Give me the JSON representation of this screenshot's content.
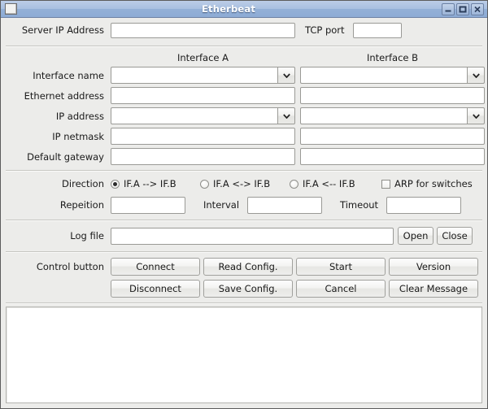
{
  "window": {
    "title": "Etherbeat",
    "icon": "app-window-icon",
    "controls": {
      "minimize": "minimize-icon",
      "maximize": "maximize-icon",
      "close": "close-icon"
    }
  },
  "server": {
    "ip_label": "Server IP Address",
    "ip_value": "",
    "ip_placeholder": "",
    "port_label": "TCP port",
    "port_value": "",
    "port_placeholder": ""
  },
  "interfaces": {
    "header_a": "Interface A",
    "header_b": "Interface B",
    "rows": [
      {
        "label": "Interface name",
        "type": "combo",
        "a_value": "",
        "b_value": ""
      },
      {
        "label": "Ethernet address",
        "type": "text",
        "a_value": "",
        "b_value": ""
      },
      {
        "label": "IP address",
        "type": "combo",
        "a_value": "",
        "b_value": ""
      },
      {
        "label": "IP netmask",
        "type": "text",
        "a_value": "",
        "b_value": ""
      },
      {
        "label": "Default gateway",
        "type": "text",
        "a_value": "",
        "b_value": ""
      }
    ]
  },
  "direction": {
    "label": "Direction",
    "options": [
      {
        "label": "IF.A --> IF.B",
        "selected": true
      },
      {
        "label": "IF.A <-> IF.B",
        "selected": false
      },
      {
        "label": "IF.A <-- IF.B",
        "selected": false
      }
    ],
    "arp_label": "ARP for switches",
    "arp_checked": false
  },
  "timing": {
    "repetition_label": "Repeition",
    "repetition_value": "",
    "interval_label": "Interval",
    "interval_value": "",
    "timeout_label": "Timeout",
    "timeout_value": ""
  },
  "logfile": {
    "label": "Log file",
    "value": "",
    "placeholder": "",
    "open_label": "Open",
    "close_label": "Close"
  },
  "controls": {
    "label": "Control button",
    "buttons_row1": [
      "Connect",
      "Read Config.",
      "Start",
      "Version"
    ],
    "buttons_row2": [
      "Disconnect",
      "Save Config.",
      "Cancel",
      "Clear Message"
    ]
  },
  "messages": {
    "text": ""
  },
  "colors": {
    "window_bg": "#ececea",
    "title_start": "#bccde7",
    "title_end": "#8dabd5",
    "title_text": "#ffffff",
    "field_bg": "#ffffff",
    "field_border": "#9a9a96",
    "button_border": "#a0a09c"
  }
}
